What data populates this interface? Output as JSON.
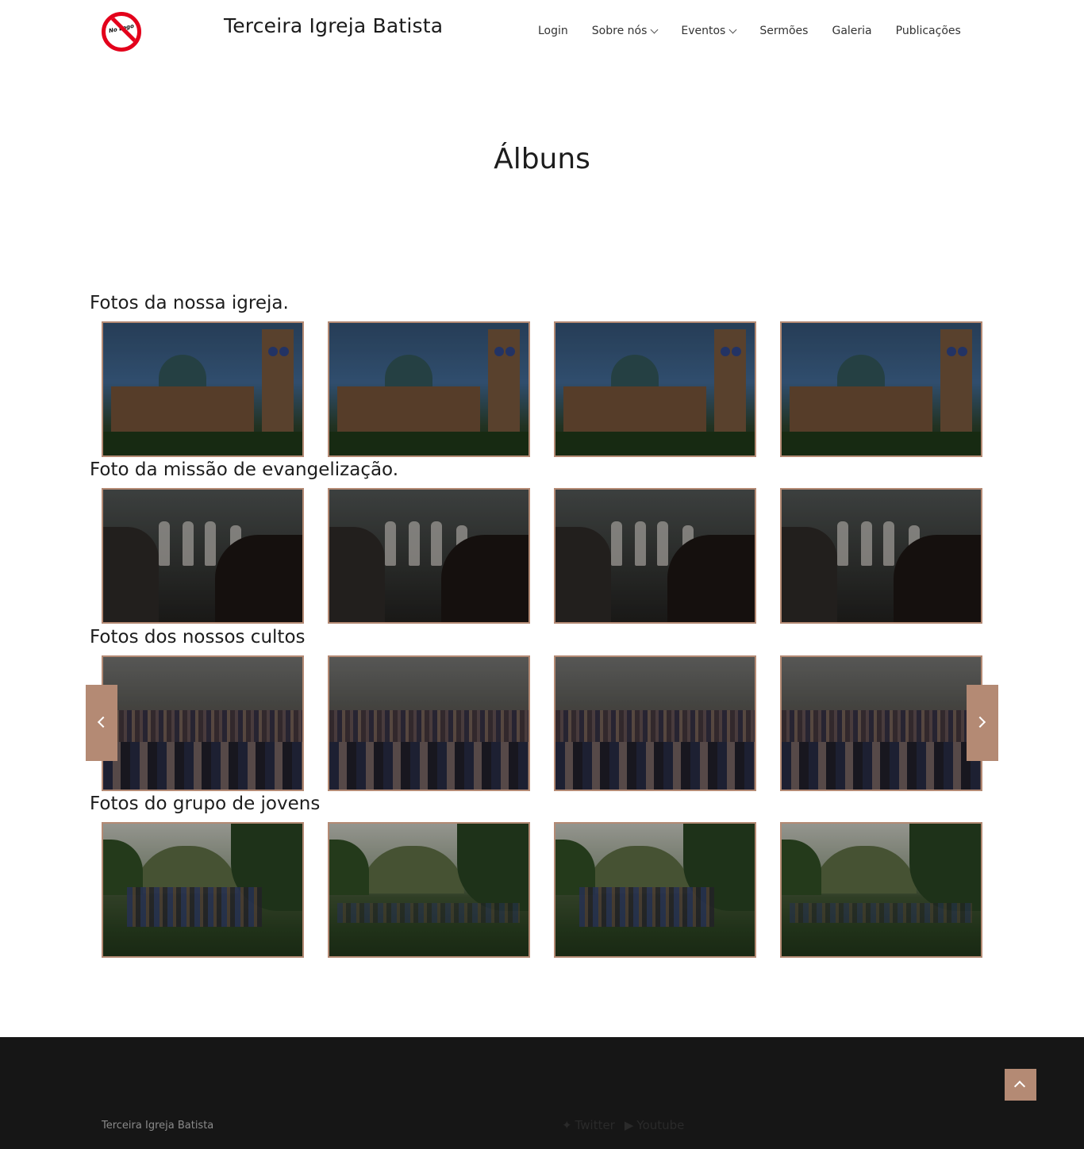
{
  "header": {
    "logo_text": "No Logo",
    "site_title": "Terceira Igreja Batista",
    "nav": [
      {
        "label": "Login"
      },
      {
        "label": "Sobre nós"
      },
      {
        "label": "Eventos"
      },
      {
        "label": "Sermões"
      },
      {
        "label": "Galeria"
      },
      {
        "label": "Publicações"
      }
    ]
  },
  "page_title": "Álbuns",
  "albums": [
    {
      "title": "Fotos da nossa igreja.",
      "image_kind": "church"
    },
    {
      "title": "Foto da missão de evangelização.",
      "image_kind": "mission"
    },
    {
      "title": "Fotos dos nossos cultos",
      "image_kind": "worship"
    },
    {
      "title": "Fotos do grupo de jovens",
      "image_kind": "youth"
    }
  ],
  "carousel": {
    "prev_icon": "chevron-left-icon",
    "next_icon": "chevron-right-icon"
  },
  "footer": {
    "brand": "Terceira Igreja Batista",
    "social": [
      {
        "icon": "twitter-icon",
        "label": "Twitter"
      },
      {
        "icon": "youtube-icon",
        "label": "Youtube"
      }
    ]
  },
  "colors": {
    "accent": "#b48a74",
    "footer_bg": "#161616",
    "logo_red": "#e3001b"
  }
}
